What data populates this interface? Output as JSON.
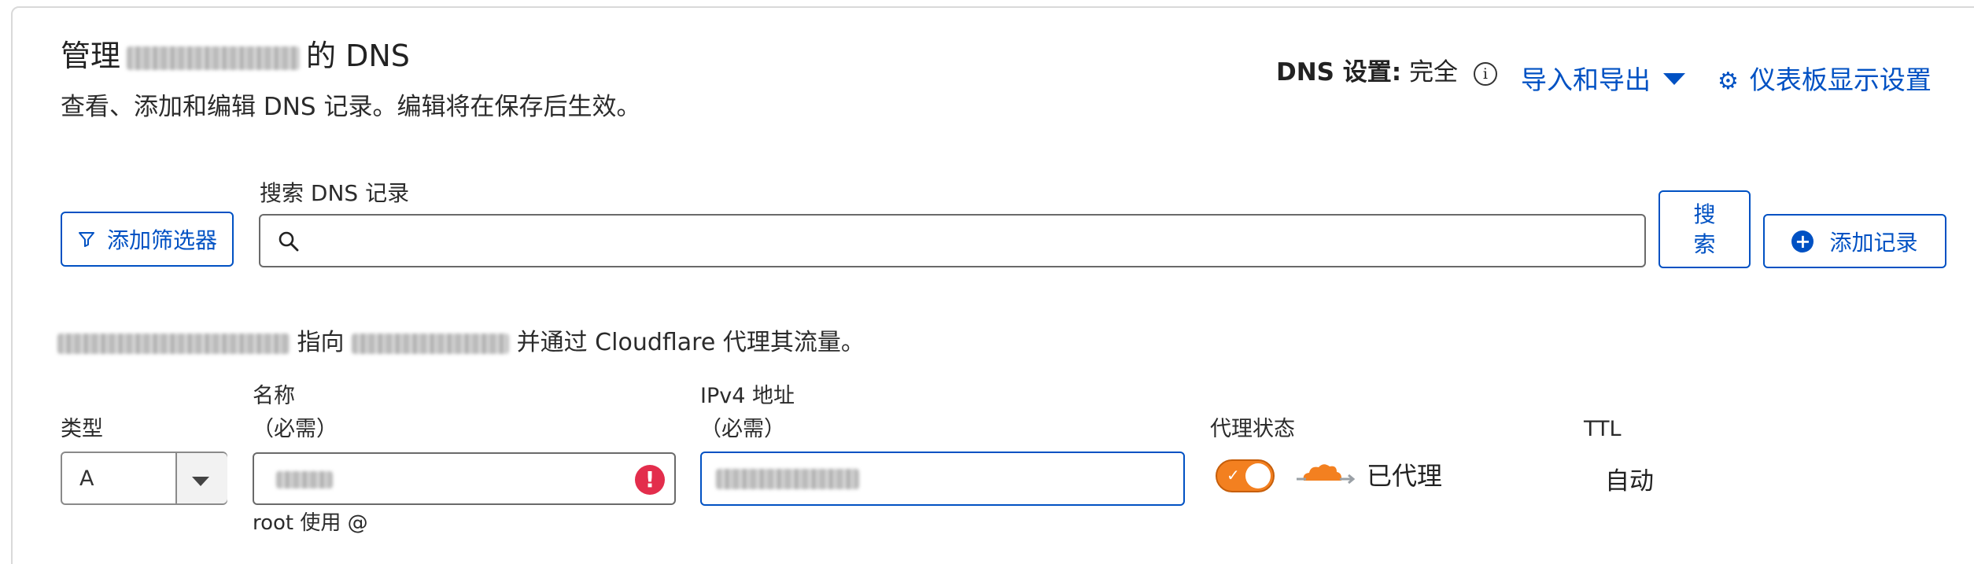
{
  "header": {
    "title_prefix": "管理",
    "title_suffix": "的 DNS",
    "description": "查看、添加和编辑 DNS 记录。编辑将在保存后生效。",
    "dns_setting_label": "DNS 设置:",
    "dns_setting_value": "完全",
    "info_icon_glyph": "i",
    "import_export_label": "导入和导出",
    "dashboard_settings_label": "仪表板显示设置"
  },
  "toolbar": {
    "filter_button_label": "添加筛选器",
    "search_label": "搜索 DNS 记录",
    "search_value": "",
    "search_button_line1": "搜",
    "search_button_line2": "索",
    "add_record_label": "添加记录",
    "add_icon_glyph": "+"
  },
  "notice": {
    "points_to": "指向",
    "proxied_through": "并通过 Cloudflare 代理其流量。"
  },
  "form": {
    "type_label": "类型",
    "type_value": "A",
    "name_label": "名称",
    "name_required": "（必需）",
    "name_hint": "root 使用 @",
    "error_glyph": "!",
    "ipv4_label": "IPv4 地址",
    "ipv4_required": "（必需）",
    "proxy_label": "代理状态",
    "proxy_status_text": "已代理",
    "proxy_enabled": true,
    "ttl_label": "TTL",
    "ttl_value": "自动"
  },
  "colors": {
    "accent": "#0051c3",
    "proxy_orange": "#f38020",
    "error_red": "#e32d4c"
  },
  "icons": [
    "info-icon",
    "caret-down-icon",
    "gear-icon",
    "filter-icon",
    "search-icon",
    "plus-circle-icon",
    "error-icon",
    "cloud-icon"
  ]
}
